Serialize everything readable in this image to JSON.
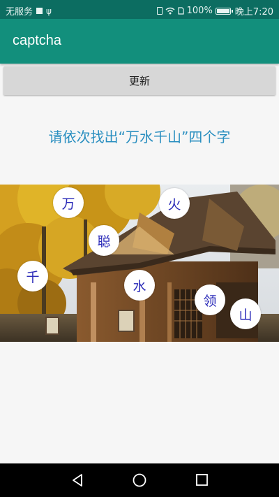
{
  "status_bar": {
    "carrier": "无服务",
    "battery_percent": "100%",
    "time": "晚上7:20"
  },
  "app_bar": {
    "title": "captcha"
  },
  "refresh_button": {
    "label": "更新"
  },
  "instruction": {
    "text": "请依次找出“万水千山”四个字"
  },
  "captcha": {
    "characters": [
      "万",
      "火",
      "聪",
      "千",
      "水",
      "领",
      "山"
    ]
  },
  "colors": {
    "status_bar": "#0c6d61",
    "app_bar": "#128f7c",
    "instruction_text": "#2a8fc0",
    "character_text": "#2a2ab8"
  },
  "icons": {
    "status": [
      "notification-square-icon",
      "usb-icon",
      "vibrate-icon",
      "wifi-icon",
      "sim-icon",
      "battery-icon"
    ],
    "nav": [
      "back-icon",
      "home-icon",
      "recents-icon"
    ]
  }
}
